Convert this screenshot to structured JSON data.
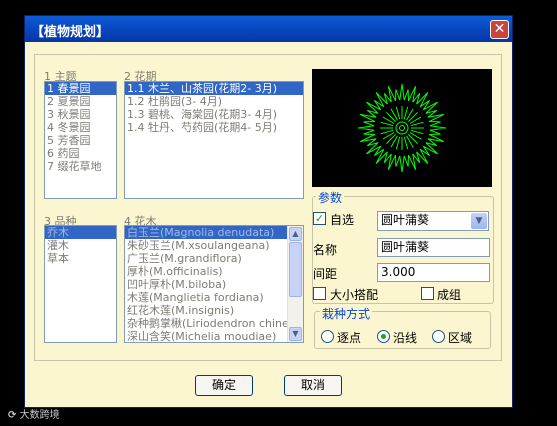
{
  "window": {
    "title": "【植物规划】"
  },
  "theme_list": {
    "label": "1 主题",
    "items": [
      "1 春景园",
      "2 夏景园",
      "3 秋景园",
      "4 冬景园",
      "5 芳香园",
      "6 药园",
      "7 缀花草地"
    ],
    "selected": 0
  },
  "period_list": {
    "label": "2 花期",
    "items": [
      "1.1 木兰、山茶园(花期2- 3月)",
      "1.2 杜鹃园(3- 4月)",
      "1.3 碧桃、海棠园(花期3- 4月)",
      "1.4 牡丹、芍药园(花期4- 5月)"
    ],
    "selected": 0
  },
  "variety_list": {
    "label": "3 品种",
    "items": [
      "乔木",
      "灌木",
      "草本"
    ],
    "selected": 0
  },
  "flower_list": {
    "label": "4 花木",
    "items": [
      "白玉兰(Magnolia denudata)",
      "朱砂玉兰(M.xsoulangeana)",
      "广玉兰(M.grandiflora)",
      "厚朴(M.officinalis)",
      "凹叶厚朴(M.biloba)",
      "木莲(Manglietia fordiana)",
      "红花木莲(M.insignis)",
      "杂种鹅掌楸(Liriodendron chinense)",
      "深山含笑(Michelia moudiae)"
    ],
    "selected": 0
  },
  "params": {
    "group_label": "参数",
    "auto_label": "自选",
    "auto_checked": true,
    "symbol_value": "圆叶蒲葵",
    "name_label": "名称",
    "name_value": "圆叶蒲葵",
    "spacing_label": "间距",
    "spacing_value": "3.000",
    "size_mix_label": "大小搭配",
    "group_check_label": "成组"
  },
  "plant_mode": {
    "group_label": "栽种方式",
    "options": [
      "逐点",
      "沿线",
      "区域"
    ],
    "selected": 1
  },
  "buttons": {
    "ok": "确定",
    "cancel": "取消"
  },
  "watermark": "大数跨境",
  "colors": {
    "titlebar": "#0a47c2",
    "dialog_bg": "#fbf6cf",
    "selection": "#3166c7",
    "preview_stroke": "#00ff00"
  }
}
